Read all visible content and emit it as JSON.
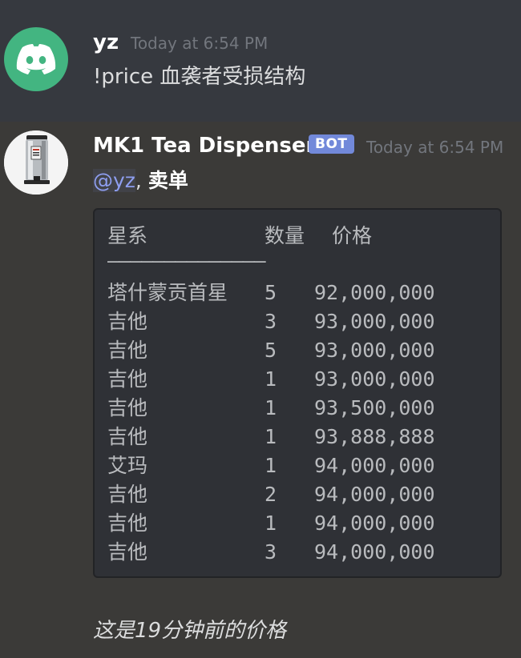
{
  "messages": [
    {
      "username": "yz",
      "timestamp": "Today at 6:54 PM",
      "text": "!price 血袭者受损结构",
      "avatar_icon": "discord-logo-icon"
    },
    {
      "username": "MK1 Tea Dispenser",
      "badge": "BOT",
      "timestamp": "Today at 6:54 PM",
      "mention": "@yz",
      "mention_sep": ",",
      "title": "卖单",
      "avatar_icon": "tea-dispenser-icon",
      "table": {
        "headers": [
          "星系",
          "数量",
          "价格"
        ],
        "separator": "——————————————",
        "rows": [
          {
            "system": "塔什蒙贡首星",
            "qty": "5",
            "price": "92,000,000"
          },
          {
            "system": "吉他",
            "qty": "3",
            "price": "93,000,000"
          },
          {
            "system": "吉他",
            "qty": "5",
            "price": "93,000,000"
          },
          {
            "system": "吉他",
            "qty": "1",
            "price": "93,000,000"
          },
          {
            "system": "吉他",
            "qty": "1",
            "price": "93,500,000"
          },
          {
            "system": "吉他",
            "qty": "1",
            "price": "93,888,888"
          },
          {
            "system": "艾玛",
            "qty": "1",
            "price": "94,000,000"
          },
          {
            "system": "吉他",
            "qty": "2",
            "price": "94,000,000"
          },
          {
            "system": "吉他",
            "qty": "1",
            "price": "94,000,000"
          },
          {
            "system": "吉他",
            "qty": "3",
            "price": "94,000,000"
          }
        ]
      },
      "footer": "这是19分钟前的价格"
    }
  ],
  "colors": {
    "background": "#36393f",
    "discord_green": "#43b581",
    "bot_badge": "#7289da",
    "mention": "#8e9ef0",
    "codeblock_bg": "#2f3136"
  }
}
